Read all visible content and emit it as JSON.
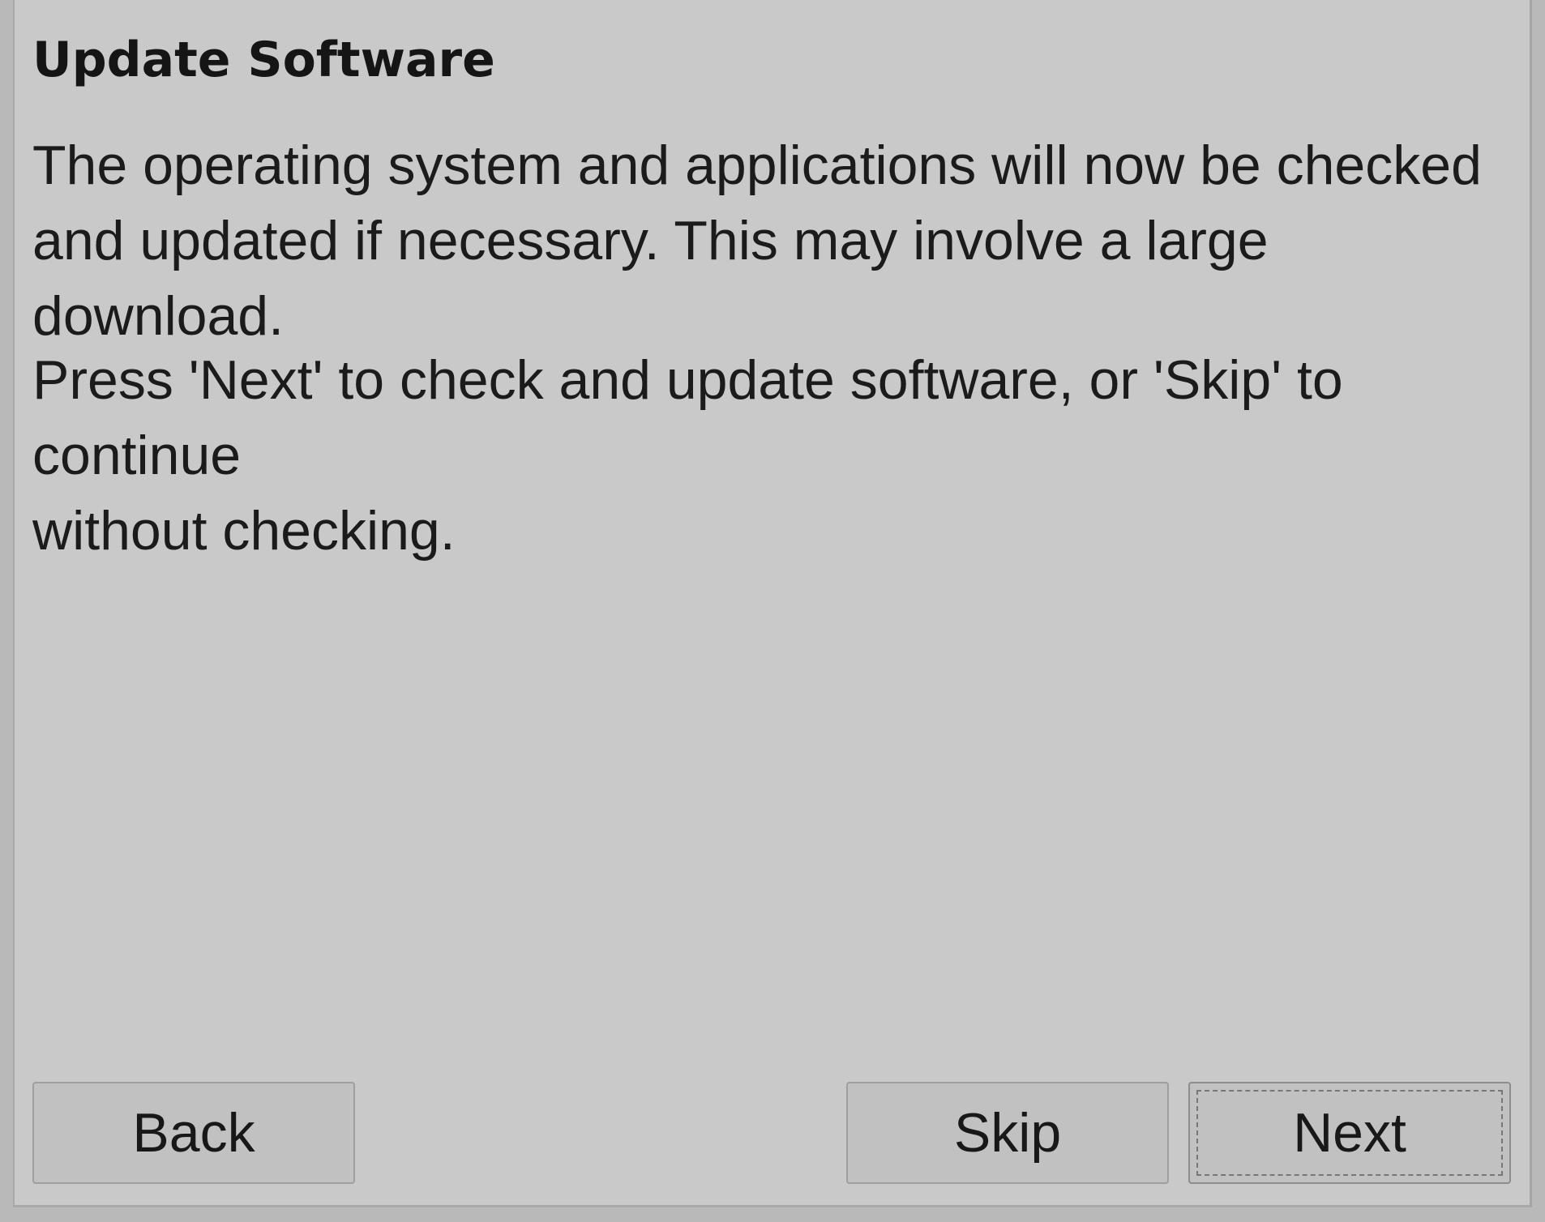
{
  "dialog": {
    "title": "Update Software",
    "message_lines": [
      "The operating system and applications will now be checked",
      "and updated if necessary. This may involve a large download."
    ],
    "instruction_lines": [
      "Press 'Next' to check and update software, or 'Skip' to continue",
      "without checking."
    ]
  },
  "buttons": {
    "back_label": "Back",
    "skip_label": "Skip",
    "next_label": "Next"
  },
  "colors": {
    "dialog_background": "#c9c9c9",
    "text": "#1b1b1b",
    "button_background": "#c1c1c1",
    "button_border": "#9f9f9f"
  }
}
